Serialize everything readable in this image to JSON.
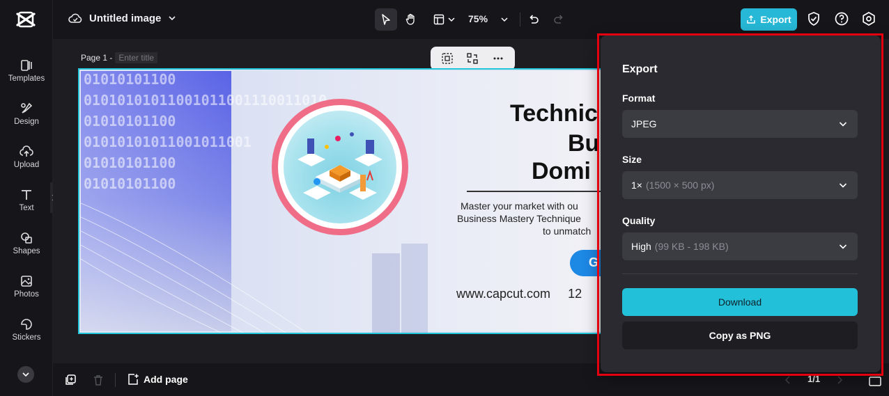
{
  "sidebar": {
    "items": [
      {
        "label": "Templates",
        "icon": "templates-icon"
      },
      {
        "label": "Design",
        "icon": "design-icon"
      },
      {
        "label": "Upload",
        "icon": "upload-icon"
      },
      {
        "label": "Text",
        "icon": "text-icon"
      },
      {
        "label": "Shapes",
        "icon": "shapes-icon"
      },
      {
        "label": "Photos",
        "icon": "photos-icon"
      },
      {
        "label": "Stickers",
        "icon": "stickers-icon"
      }
    ]
  },
  "topbar": {
    "doc_title": "Untitled image",
    "zoom": "75%",
    "export_label": "Export"
  },
  "canvas": {
    "page_label": "Page 1 -",
    "page_title_placeholder": "Enter title"
  },
  "design": {
    "binary_lines": [
      "01010101100",
      "01010101011001011001110011010",
      "01010101100",
      "01010101011001011001",
      "01010101100",
      "01010101100"
    ],
    "headline_lines": [
      "Technic",
      "Bu",
      "Domi"
    ],
    "body_lines": [
      "Master your market with ou",
      "Business Mastery Technique",
      "to unmatch"
    ],
    "cta_text": "G",
    "url": "www.capcut.com",
    "url_suffix": "12"
  },
  "bottombar": {
    "add_page_label": "Add page",
    "pager": "1/1"
  },
  "export_panel": {
    "title": "Export",
    "format_label": "Format",
    "format_value": "JPEG",
    "size_label": "Size",
    "size_value": "1×",
    "size_detail": "(1500 × 500 px)",
    "quality_label": "Quality",
    "quality_value": "High",
    "quality_detail": "(99 KB - 198 KB)",
    "download_label": "Download",
    "copy_label": "Copy as PNG"
  },
  "colors": {
    "accent": "#26b8d6",
    "highlight": "#e4000f",
    "ring": "#f06d87"
  }
}
